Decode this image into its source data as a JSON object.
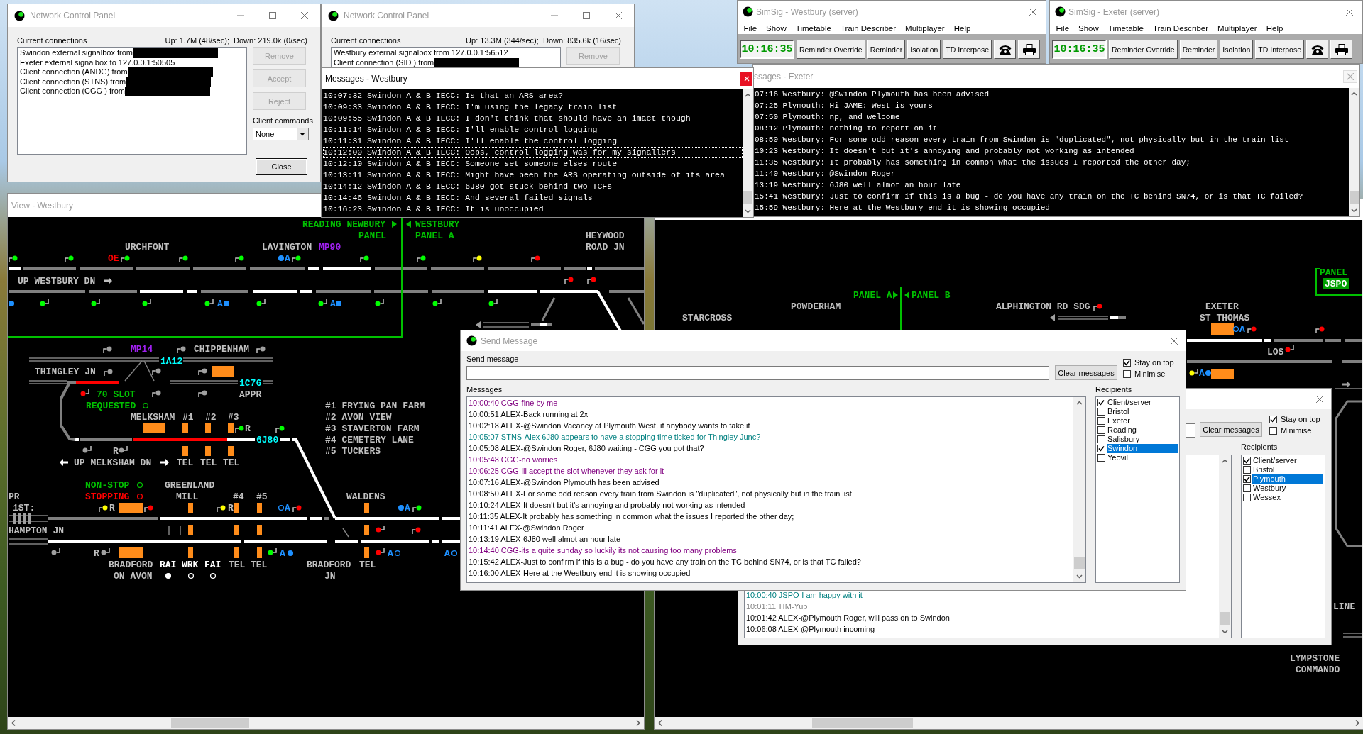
{
  "network_panels": [
    {
      "title": "Network Control Panel",
      "connections_label": "Current connections",
      "traffic": "Up: 1.7M (48/sec);  Down: 219.0k (0/sec)",
      "connections": [
        {
          "text": "Swindon external signalbox from",
          "redacted": true
        },
        {
          "text": "Exeter external signalbox to 127.0.0.1:50505",
          "redacted": false
        },
        {
          "text": "Client connection (ANDG) from",
          "redacted": true
        },
        {
          "text": "Client connection (STNS) from",
          "redacted": true
        },
        {
          "text": "Client connection (CGG ) from",
          "redacted": true
        }
      ],
      "buttons": [
        {
          "label": "Remove",
          "disabled": true
        },
        {
          "label": "Accept",
          "disabled": true
        },
        {
          "label": "Reject",
          "disabled": true
        }
      ],
      "client_commands": {
        "label": "Client commands",
        "value": "None"
      },
      "close_button": "Close"
    },
    {
      "title": "Network Control Panel",
      "connections_label": "Current connections",
      "traffic": "Up: 13.3M (344/sec);  Down: 835.6k (16/sec)",
      "connections": [
        {
          "text": "Westbury external signalbox from 127.0.0.1:56512",
          "redacted": false
        },
        {
          "text": "Client connection (SID ) from",
          "redacted": true
        }
      ],
      "buttons": [
        {
          "label": "Remove",
          "disabled": true
        }
      ]
    }
  ],
  "message_log_westbury": {
    "title": "Messages - Westbury",
    "lines": [
      {
        "text": "10:07:32 Swindon A & B IECC: Is that an ARS area?",
        "selected": false
      },
      {
        "text": "10:09:33 Swindon A & B IECC: I'm using the legacy train list",
        "selected": false
      },
      {
        "text": "10:09:55 Swindon A & B IECC: I don't think that should have an imact though",
        "selected": false
      },
      {
        "text": "10:11:14 Swindon A & B IECC: I'll enable control logging",
        "selected": false
      },
      {
        "text": "10:11:31 Swindon A & B IECC: I'll enable the control logging",
        "selected": false
      },
      {
        "text": "10:12:00 Swindon A & B IECC: Oops, control logging was for my signallers",
        "selected": true
      },
      {
        "text": "10:12:10 Swindon A & B IECC: Someone set someone elses route",
        "selected": false
      },
      {
        "text": "10:13:11 Swindon A & B IECC: Might have been the ARS operating outside of its area",
        "selected": false
      },
      {
        "text": "10:14:12 Swindon A & B IECC: 6J80 got stuck behind two TCFs",
        "selected": false
      },
      {
        "text": "10:14:46 Swindon A & B IECC: And several failed signals",
        "selected": false
      },
      {
        "text": "10:16:23 Swindon A & B IECC: It is unoccupied",
        "selected": false
      }
    ]
  },
  "simsig_windows": [
    {
      "title": "SimSig - Westbury (server)",
      "menu": [
        "File",
        "Show",
        "Timetable",
        "Train Describer",
        "Multiplayer",
        "Help"
      ],
      "clock": "10:16:35",
      "buttons": [
        "Reminder Override",
        "Reminder",
        "Isolation",
        "TD Interpose"
      ]
    },
    {
      "title": "SimSig - Exeter (server)",
      "menu": [
        "File",
        "Show",
        "Timetable",
        "Train Describer",
        "Multiplayer",
        "Help"
      ],
      "clock": "10:16:35",
      "buttons": [
        "Reminder Override",
        "Reminder",
        "Isolation",
        "TD Interpose"
      ]
    }
  ],
  "message_log_exeter": {
    "title": "ssages - Exeter",
    "lines": [
      "07:16 Westbury: @Swindon Plymouth has been advised",
      "07:25 Plymouth: Hi JAME: West is yours",
      "07:50 Plymouth: np, and welcome",
      "08:12 Plymouth: nothing to report on it",
      "08:50 Westbury: For some odd reason every train from Swindon is \"duplicated\", not physically but in the train list",
      "10:23 Westbury: It doesn't but it's annoying and probably not working as intended",
      "11:35 Westbury: It probably has something in common what the issues I reported the other day;",
      "11:40 Westbury: @Swindon Roger",
      "13:19 Westbury: 6J80 well almot an hour late",
      "15:41 Westbury: Just to confirm if this is a bug - do you have any train on the TC behind SN74, or is that TC failed?",
      "15:59 Westbury: Here at the Westbury end it is showing occupied"
    ]
  },
  "view_westbury": {
    "title": "View - Westbury",
    "labels": [
      {
        "text": "READING NEWBURY",
        "color": "#00c000"
      },
      {
        "text": "WESTBURY",
        "color": "#00c000"
      },
      {
        "text": "PANEL",
        "color": "#00c000"
      },
      {
        "text": "PANEL A",
        "color": "#00c000"
      },
      {
        "text": "HEYWOOD",
        "color": "#c0c0c0"
      },
      {
        "text": "URCHFONT",
        "color": "#c0c0c0"
      },
      {
        "text": "LAVINGTON",
        "color": "#c0c0c0"
      },
      {
        "text": "MP90",
        "color": "#a020f0"
      },
      {
        "text": "ROAD JN",
        "color": "#c0c0c0"
      },
      {
        "text": "OE",
        "color": "#ff0000"
      },
      {
        "text": "A",
        "color": "#1e90ff"
      },
      {
        "text": "UP WESTBURY DN",
        "color": "#c0c0c0"
      },
      {
        "text": "A",
        "color": "#1e90ff"
      },
      {
        "text": "A",
        "color": "#1e90ff"
      },
      {
        "text": "MP14",
        "color": "#a020f0"
      },
      {
        "text": "CHIPPENHAM",
        "color": "#c0c0c0"
      },
      {
        "text": "1A12",
        "color": "#00ffff"
      },
      {
        "text": "THINGLEY JN",
        "color": "#c0c0c0"
      },
      {
        "text": "1C76",
        "color": "#00ffff"
      },
      {
        "text": "70 SLOT",
        "color": "#00c000"
      },
      {
        "text": "APPR",
        "color": "#c0c0c0"
      },
      {
        "text": "REQUESTED",
        "color": "#00c000"
      },
      {
        "text": "#1 FRYING PAN FARM",
        "color": "#c0c0c0"
      },
      {
        "text": "MELKSHAM",
        "color": "#c0c0c0"
      },
      {
        "text": "#1",
        "color": "#c0c0c0"
      },
      {
        "text": "#2",
        "color": "#c0c0c0"
      },
      {
        "text": "#3",
        "color": "#c0c0c0"
      },
      {
        "text": "#2 AVON VIEW",
        "color": "#c0c0c0"
      },
      {
        "text": "R",
        "color": "#c0c0c0"
      },
      {
        "text": "#3 STAVERTON FARM",
        "color": "#c0c0c0"
      },
      {
        "text": "6J80",
        "color": "#00ffff"
      },
      {
        "text": "#4 CEMETERY LANE",
        "color": "#c0c0c0"
      },
      {
        "text": "R",
        "color": "#c0c0c0"
      },
      {
        "text": "#5 TUCKERS",
        "color": "#c0c0c0"
      },
      {
        "text": "UP MELKSHAM DN",
        "color": "#c0c0c0"
      },
      {
        "text": "TEL",
        "color": "#c0c0c0"
      },
      {
        "text": "TEL",
        "color": "#c0c0c0"
      },
      {
        "text": "TEL",
        "color": "#c0c0c0"
      },
      {
        "text": "NON-STOP",
        "color": "#00c000"
      },
      {
        "text": "GREENLAND",
        "color": "#c0c0c0"
      },
      {
        "text": "PR",
        "color": "#c0c0c0"
      },
      {
        "text": "STOPPING",
        "color": "#ff0000"
      },
      {
        "text": "MILL",
        "color": "#c0c0c0"
      },
      {
        "text": "#4",
        "color": "#c0c0c0"
      },
      {
        "text": "#5",
        "color": "#c0c0c0"
      },
      {
        "text": "WALDENS",
        "color": "#c0c0c0"
      },
      {
        "text": "1ST:",
        "color": "#c0c0c0"
      },
      {
        "text": "R",
        "color": "#c0c0c0"
      },
      {
        "text": "R",
        "color": "#c0c0c0"
      },
      {
        "text": "A",
        "color": "#1e90ff"
      },
      {
        "text": "A",
        "color": "#1e90ff"
      },
      {
        "text": "HAMPTON JN",
        "color": "#c0c0c0"
      },
      {
        "text": "R",
        "color": "#c0c0c0"
      },
      {
        "text": "A",
        "color": "#1e90ff"
      },
      {
        "text": "A",
        "color": "#1e90ff"
      },
      {
        "text": "A",
        "color": "#1e90ff"
      },
      {
        "text": "BRADFORD",
        "color": "#c0c0c0"
      },
      {
        "text": "RAI",
        "color": "#ffffff"
      },
      {
        "text": "WRK",
        "color": "#ffffff"
      },
      {
        "text": "FAI",
        "color": "#ffffff"
      },
      {
        "text": "TEL",
        "color": "#c0c0c0"
      },
      {
        "text": "TEL",
        "color": "#c0c0c0"
      },
      {
        "text": "BRADFORD",
        "color": "#c0c0c0"
      },
      {
        "text": "TEL",
        "color": "#c0c0c0"
      },
      {
        "text": "ON AVON",
        "color": "#c0c0c0"
      },
      {
        "text": "JN",
        "color": "#c0c0c0"
      }
    ],
    "signals": [
      {
        "color": "#00ff00"
      },
      {
        "color": "#00ff00"
      },
      {
        "color": "#00ff00"
      },
      {
        "color": "#00ff00"
      },
      {
        "color": "#00ff00"
      },
      {
        "color": "#00ff00"
      },
      {
        "color": "#00ff00"
      },
      {
        "color": "#00ff00"
      },
      {
        "color": "#ffff00"
      },
      {
        "color": "#ff0000"
      },
      {
        "color": "#00ff00"
      },
      {
        "color": "#00ff00"
      },
      {
        "color": "#00ff00"
      },
      {
        "color": "#00ff00"
      },
      {
        "color": "#00ff00"
      },
      {
        "color": "#00ff00"
      },
      {
        "color": "#00ff00"
      },
      {
        "color": "#00ff00"
      },
      {
        "color": "#00ff00"
      },
      {
        "color": "#ff0000"
      },
      {
        "color": "#ff0000"
      },
      {
        "color": "#a0a0a0"
      },
      {
        "color": "#a0a0a0"
      },
      {
        "color": "#a0a0a0"
      },
      {
        "color": "#a0a0a0"
      },
      {
        "color": "#a0a0a0"
      },
      {
        "color": "#a0a0a0"
      },
      {
        "color": "#a0a0a0"
      },
      {
        "color": "#a0a0a0"
      },
      {
        "color": "#ff0000"
      },
      {
        "color": "#00ff00"
      },
      {
        "color": "#00ff00"
      },
      {
        "color": "#a0a0a0"
      },
      {
        "color": "#a0a0a0"
      },
      {
        "color": "#ffff00"
      },
      {
        "color": "#ff0000"
      },
      {
        "color": "#ffff00"
      },
      {
        "color": "#ff0000"
      },
      {
        "color": "#00ff00"
      },
      {
        "color": "#ff0000"
      },
      {
        "color": "#ff0000"
      },
      {
        "color": "#a0a0a0"
      },
      {
        "color": "#a0a0a0"
      },
      {
        "color": "#00ff00"
      },
      {
        "color": "#ff0000"
      }
    ],
    "indicators": [
      {
        "color": "#00c000",
        "on": false
      },
      {
        "color": "#00c000",
        "on": false
      },
      {
        "color": "#ff0000",
        "on": false
      },
      {
        "color": "#ffffff",
        "on": true
      },
      {
        "color": "#ffffff",
        "on": false
      },
      {
        "color": "#ffffff",
        "on": false
      },
      {
        "color": "#1e90ff",
        "on": true
      },
      {
        "color": "#1e90ff",
        "on": true
      },
      {
        "color": "#1e90ff",
        "on": true
      },
      {
        "color": "#1e90ff",
        "on": true
      },
      {
        "color": "#1e90ff",
        "on": false
      },
      {
        "color": "#1e90ff",
        "on": true
      },
      {
        "color": "#1e90ff",
        "on": true
      },
      {
        "color": "#1e90ff",
        "on": false
      },
      {
        "color": "#1e90ff",
        "on": false
      }
    ]
  },
  "view_exeter": {
    "labels": [
      {
        "text": "PANEL",
        "color": "#00c000"
      },
      {
        "text": "PANEL A",
        "color": "#00c000"
      },
      {
        "text": "PANEL B",
        "color": "#00c000"
      },
      {
        "text": "POWDERHAM",
        "color": "#c0c0c0"
      },
      {
        "text": "ALPHINGTON RD SDG",
        "color": "#c0c0c0"
      },
      {
        "text": "EXETER",
        "color": "#c0c0c0"
      },
      {
        "text": "STARCROSS",
        "color": "#c0c0c0"
      },
      {
        "text": "ST THOMAS",
        "color": "#c0c0c0"
      },
      {
        "text": "A",
        "color": "#1e90ff"
      },
      {
        "text": "LOS",
        "color": "#c0c0c0"
      },
      {
        "text": "A",
        "color": "#1e90ff"
      },
      {
        "text": "LINE",
        "color": "#c0c0c0"
      },
      {
        "text": "LYMPSTONE",
        "color": "#c0c0c0"
      },
      {
        "text": "COMMANDO",
        "color": "#c0c0c0"
      }
    ],
    "operator_tag": "JSPO",
    "signals": [
      {
        "color": "#ff0000"
      },
      {
        "color": "#ff0000"
      },
      {
        "color": "#ff0000"
      },
      {
        "color": "#ff0000"
      },
      {
        "color": "#ffff00"
      }
    ],
    "indicators": [
      {
        "color": "#1e90ff",
        "on": false
      },
      {
        "color": "#1e90ff",
        "on": true
      }
    ]
  },
  "send_message_westbury": {
    "title": "Send Message",
    "send_label": "Send message",
    "clear_button": "Clear messages",
    "options": [
      {
        "label": "Stay on top",
        "checked": true
      },
      {
        "label": "Minimise",
        "checked": false
      }
    ],
    "messages_label": "Messages",
    "messages": [
      {
        "text": "10:00:40 CGG-fine by me",
        "color": "#800080"
      },
      {
        "text": "10:00:51 ALEX-Back running at 2x",
        "color": "#000000"
      },
      {
        "text": "10:02:18 ALEX-@Swindon Vacancy at Plymouth West, if anybody wants to take it",
        "color": "#000000"
      },
      {
        "text": "10:05:07 STNS-Alex 6J80 appears to have a stopping time ticked for Thingley Junc?",
        "color": "#008080"
      },
      {
        "text": "10:05:08 ALEX-@Swindon Roger, 6J80 waiting - CGG you got that?",
        "color": "#000000"
      },
      {
        "text": "10:05:48 CGG-no worries",
        "color": "#800080"
      },
      {
        "text": "10:06:25 CGG-ill accept the slot whenever they ask for it",
        "color": "#800080"
      },
      {
        "text": "10:07:16 ALEX-@Swindon Plymouth has been advised",
        "color": "#000000"
      },
      {
        "text": "10:08:50 ALEX-For some odd reason every train from Swindon is \"duplicated\", not physically but in the train list",
        "color": "#000000"
      },
      {
        "text": "10:10:24 ALEX-It doesn't but it's annoying and probably not working as intended",
        "color": "#000000"
      },
      {
        "text": "10:11:35 ALEX-It probably has something in common what the issues I reported the other day;",
        "color": "#000000"
      },
      {
        "text": "10:11:41 ALEX-@Swindon Roger",
        "color": "#000000"
      },
      {
        "text": "10:13:19 ALEX-6J80 well almot an hour late",
        "color": "#000000"
      },
      {
        "text": "10:14:40 CGG-its a quite sunday so luckily its not causing too many problems",
        "color": "#800080"
      },
      {
        "text": "10:15:42 ALEX-Just to confirm if this is a bug - do you have any train on the TC behind SN74, or is that TC failed?",
        "color": "#000000"
      },
      {
        "text": "10:16:00 ALEX-Here at the Westbury end it is showing occupied",
        "color": "#000000"
      }
    ],
    "recipients_label": "Recipients",
    "recipients": [
      {
        "name": "Client/server",
        "checked": true,
        "selected": false
      },
      {
        "name": "Bristol",
        "checked": false,
        "selected": false
      },
      {
        "name": "Exeter",
        "checked": false,
        "selected": false
      },
      {
        "name": "Reading",
        "checked": false,
        "selected": false
      },
      {
        "name": "Salisbury",
        "checked": false,
        "selected": false
      },
      {
        "name": "Swindon",
        "checked": true,
        "selected": true
      },
      {
        "name": "Yeovil",
        "checked": false,
        "selected": false
      }
    ]
  },
  "send_message_exeter": {
    "clear_button": "Clear messages",
    "options": [
      {
        "label": "Stay on top",
        "checked": true
      },
      {
        "label": "Minimise",
        "checked": false
      }
    ],
    "recipients_label": "Recipients",
    "recipients": [
      {
        "name": "Client/server",
        "checked": true,
        "selected": false
      },
      {
        "name": "Bristol",
        "checked": false,
        "selected": false
      },
      {
        "name": "Plymouth",
        "checked": true,
        "selected": true
      },
      {
        "name": "Westbury",
        "checked": false,
        "selected": false
      },
      {
        "name": "Wessex",
        "checked": false,
        "selected": false
      }
    ],
    "messages": [
      {
        "text": "10:00:40 JSPO-I am happy with it",
        "color": "#008080"
      },
      {
        "text": "10:01:11 TIM-Yup",
        "color": "#808080"
      },
      {
        "text": "10:01:42 ALEX-@Plymouth Roger, will pass on to Swindon",
        "color": "#000000"
      },
      {
        "text": "10:06:08 ALEX-@Plymouth incoming",
        "color": "#000000"
      }
    ]
  }
}
